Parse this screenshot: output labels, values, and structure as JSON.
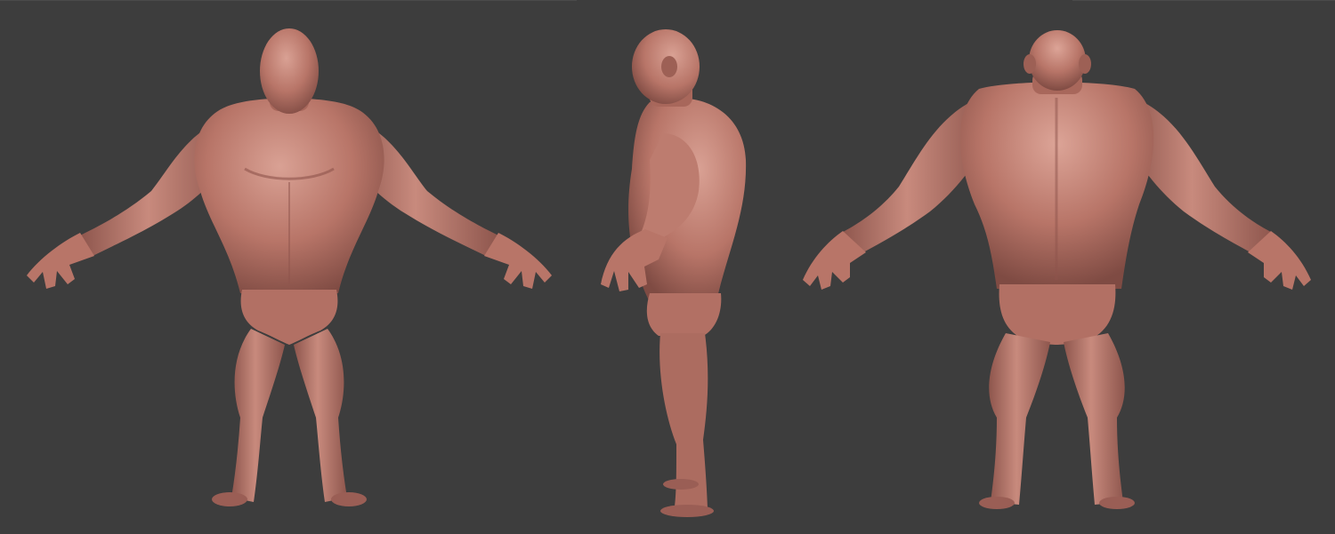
{
  "scene": {
    "background": "#3d3d3d",
    "clay_base": "#b87568",
    "clay_light": "#d79d90",
    "clay_shadow": "#7f4b43"
  },
  "views": [
    {
      "name": "front",
      "pose": "a-pose"
    },
    {
      "name": "side",
      "pose": "a-pose"
    },
    {
      "name": "back",
      "pose": "a-pose"
    }
  ]
}
